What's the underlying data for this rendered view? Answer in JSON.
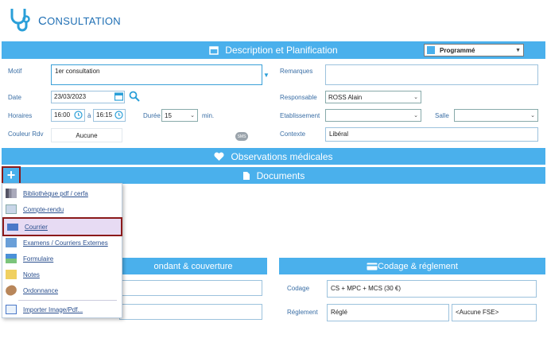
{
  "header": {
    "title_first": "C",
    "title_rest": "ONSULTATION"
  },
  "band_description": {
    "label": "Description  et Planification"
  },
  "status_select": {
    "value": "Programmé"
  },
  "form": {
    "motif_label": "Motif",
    "motif_value": "1er consultation",
    "remarques_label": "Remarques",
    "date_label": "Date",
    "date_value": "23/03/2023",
    "responsable_label": "Responsable",
    "responsable_value": "ROSS Alain",
    "horaires_label": "Horaires",
    "start_time": "16:00",
    "a_label": "à",
    "end_time": "16:15",
    "duree_label": "Durée",
    "duree_value": "15",
    "min_label": "min.",
    "etablissement_label": "Etablissement",
    "salle_label": "Salle",
    "couleur_label": "Couleur Rdv",
    "couleur_value": "Aucune",
    "sms_label": "SMS",
    "contexte_label": "Contexte",
    "contexte_value": "Libéral"
  },
  "band_observations": {
    "label": "Observations médicales"
  },
  "band_documents": {
    "label": "Documents"
  },
  "menu": {
    "items": [
      {
        "label": "Bibliothèque pdf / cerfa"
      },
      {
        "label": "Compte-rendu"
      },
      {
        "label": "Courrier"
      },
      {
        "label": "Examens / Courriers Externes"
      },
      {
        "label": "Formulaire"
      },
      {
        "label": "Notes"
      },
      {
        "label": "Ordonnance"
      },
      {
        "label": "Importer Image/Pdf..."
      }
    ]
  },
  "panel_left": {
    "label": "ondant  & couverture"
  },
  "panel_right": {
    "label": "Codage & réglement"
  },
  "codage": {
    "label": "Codage",
    "value": "CS + MPC + MCS (30 €)"
  },
  "reglement": {
    "label": "Réglement",
    "value": "Réglé",
    "fse_value": "<Aucune FSE>"
  },
  "colors": {
    "accent": "#4ab0ec",
    "title": "#1f6fb4",
    "highlight": "#8b1a1a"
  }
}
